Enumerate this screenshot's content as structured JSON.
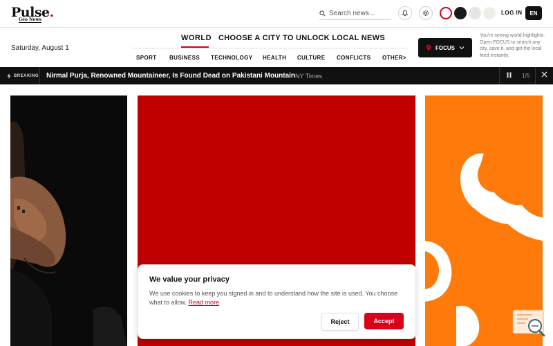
{
  "header": {
    "logo": "Pulse",
    "logo_dot": ".",
    "logo_sub": "Geo News",
    "search_placeholder": "Search news...",
    "login": "LOG IN",
    "lang": "EN",
    "theme_swatches": [
      "#ffffff",
      "#1a1a1a",
      "#e6e6e6",
      "#eeeee9"
    ],
    "date": "Saturday, August 1"
  },
  "nav": {
    "world": "WORLD",
    "city_prompt": "CHOOSE A CITY TO UNLOCK LOCAL NEWS",
    "categories": [
      "SPORT",
      "BUSINESS",
      "TECHNOLOGY",
      "HEALTH",
      "CULTURE",
      "CONFLICTS",
      "OTHER>"
    ]
  },
  "focus": {
    "button": "FOCUS",
    "note": "You're seeing world highlights. Open FOCUS to search any city, save it, and get the local feed instantly."
  },
  "breaking": {
    "label": "BREAKING",
    "headline": "Nirmal Purja, Renowned Mountaineer, Is Found Dead on Pakistani Mountain",
    "source": "NY Times",
    "counter": "1/5"
  },
  "cookie": {
    "title": "We value your privacy",
    "text": "We use cookies to keep you signed in and to understand how the site is used. You choose what to allow.",
    "link": "Read more",
    "reject": "Reject",
    "accept": "Accept"
  },
  "colors": {
    "accent": "#d0021b",
    "card_red": "#c00000",
    "card_orange": "#fe7a0b",
    "bar": "#111111"
  }
}
